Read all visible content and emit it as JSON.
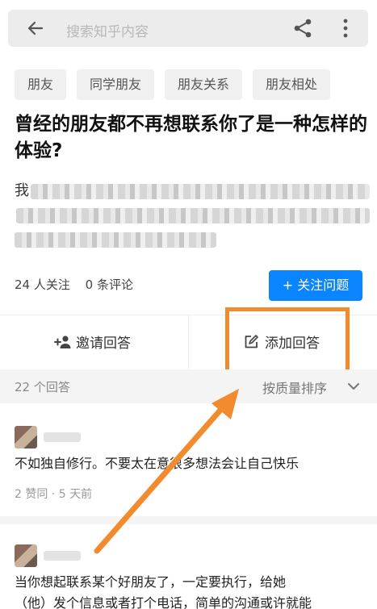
{
  "header": {
    "search_placeholder": "搜索知乎内容",
    "icons": [
      "arrow-left-icon",
      "share-icon",
      "more-vertical-icon"
    ]
  },
  "tags": [
    "朋友",
    "同学朋友",
    "朋友关系",
    "朋友相处"
  ],
  "question": {
    "title": "曾经的朋友都不再想联系你了是一种怎样的体验?",
    "excerpt_visible_start": "我"
  },
  "stats": {
    "followers": "24 人关注",
    "comments": "0 条评论"
  },
  "follow_button": "+ 关注问题",
  "actions": {
    "invite": "邀请回答",
    "write_answer": "添加回答"
  },
  "answers_bar": {
    "count": "22 个回答",
    "sort": "按质量排序"
  },
  "answers": [
    {
      "text": "不如独自修行。不要太在意很多想法会让自己快乐",
      "meta": "2 赞同 · 5 天前"
    },
    {
      "text_line1": "当你想起联系某个好朋友了，一定要执行，给她",
      "text_line2": "（他）发个信息或者打个电话，简单的沟通或许就能"
    }
  ],
  "colors": {
    "accent": "#0a84ff",
    "highlight": "#f28a2e"
  }
}
